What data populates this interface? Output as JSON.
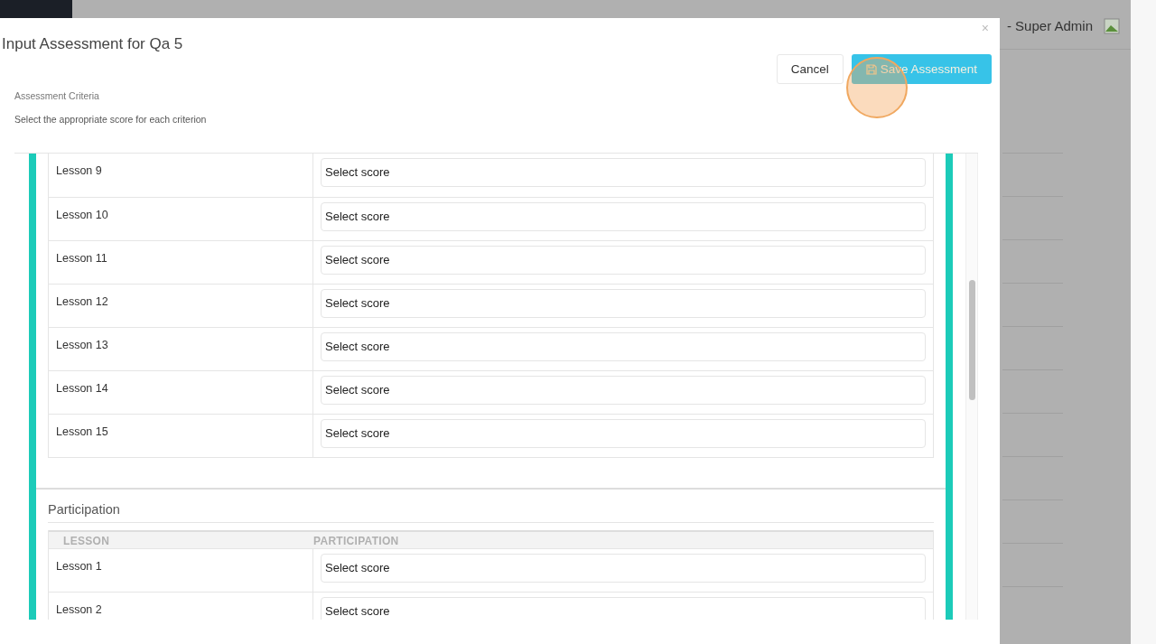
{
  "background": {
    "user_label": "- Super Admin"
  },
  "modal": {
    "title": "Input Assessment for Qa 5",
    "close": "×",
    "cancel": "Cancel",
    "save": "Save Assessment",
    "section_label": "Assessment Criteria",
    "instructions": "Select the appropriate score for each criterion",
    "sections": [
      {
        "rows": [
          {
            "lesson": "Lesson 9",
            "value": "Select score"
          },
          {
            "lesson": "Lesson 10",
            "value": "Select score"
          },
          {
            "lesson": "Lesson 11",
            "value": "Select score"
          },
          {
            "lesson": "Lesson 12",
            "value": "Select score"
          },
          {
            "lesson": "Lesson 13",
            "value": "Select score"
          },
          {
            "lesson": "Lesson 14",
            "value": "Select score"
          },
          {
            "lesson": "Lesson 15",
            "value": "Select score"
          }
        ]
      },
      {
        "title": "Participation",
        "columns": [
          "LESSON",
          "PARTICIPATION"
        ],
        "rows": [
          {
            "lesson": "Lesson 1",
            "value": "Select score"
          },
          {
            "lesson": "Lesson 2",
            "value": "Select score"
          }
        ]
      }
    ]
  }
}
